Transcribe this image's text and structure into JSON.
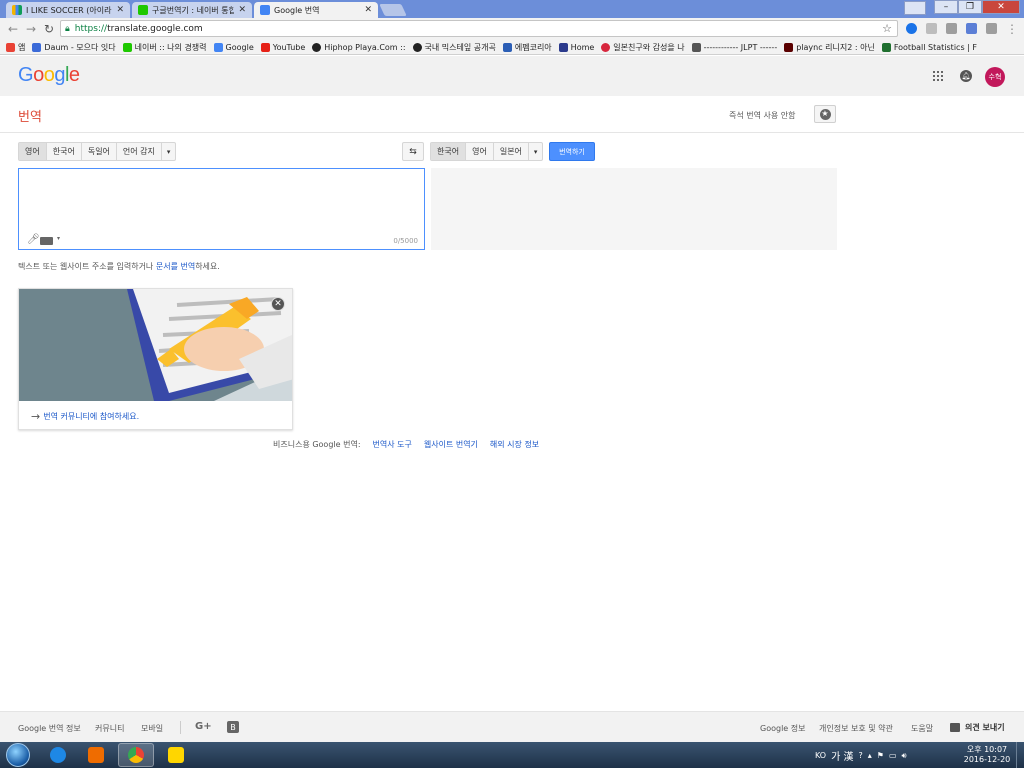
{
  "browser": {
    "tabs": [
      {
        "title": "I LIKE SOCCER (아이라이",
        "active": false
      },
      {
        "title": "구글번역기 : 네이버 통합",
        "active": false
      },
      {
        "title": "Google 번역",
        "active": true
      }
    ],
    "address": {
      "scheme": "https://",
      "host": "translate.google.com"
    },
    "bookmarks": [
      {
        "label": "앱",
        "color": "#e94235"
      },
      {
        "label": "Daum - 모으다 잇다",
        "color": "#3b6ad8"
      },
      {
        "label": "네이버 :: 나의 경쟁력",
        "color": "#1ec800"
      },
      {
        "label": "Google",
        "color": "#4285f4"
      },
      {
        "label": "YouTube",
        "color": "#e62117"
      },
      {
        "label": "Hiphop Playa.Com ::",
        "color": "#222222"
      },
      {
        "label": "국내 믹스테잎 공개곡",
        "color": "#222222"
      },
      {
        "label": "에펨코리아",
        "color": "#2b5eb5"
      },
      {
        "label": "Home",
        "color": "#2b3a8c"
      },
      {
        "label": "일본친구와 감성을 나",
        "color": "#d7263d"
      },
      {
        "label": "------------ JLPT ------",
        "color": "#555555"
      },
      {
        "label": "plaync 리니지2 : 아닌",
        "color": "#5a0000"
      },
      {
        "label": "Football Statistics | F",
        "color": "#1f6f2f"
      }
    ]
  },
  "header": {
    "logo": "Google",
    "avatar_text": "수혁"
  },
  "subheader": {
    "title": "번역",
    "instant_label": "즉석 번역 사용 안함"
  },
  "source_langs": {
    "items": [
      "영어",
      "한국어",
      "독일어",
      "언어 감지"
    ],
    "selected": 0
  },
  "target_langs": {
    "items": [
      "한국어",
      "영어",
      "일본어"
    ],
    "selected": 0
  },
  "translate_button": "번역하기",
  "source": {
    "value": "",
    "char_count": "0/5000"
  },
  "hint": {
    "prefix": "텍스트 또는 웹사이트 주소를 입력하거나 ",
    "link": "문서를 번역",
    "suffix": "하세요."
  },
  "card": {
    "link": "번역 커뮤니티에 참여하세요."
  },
  "business": {
    "label": "비즈니스용 Google 번역:",
    "links": [
      "번역사 도구",
      "웹사이트 번역기",
      "해외 시장 정보"
    ]
  },
  "footer": {
    "left": [
      "Google 번역 정보",
      "커뮤니티",
      "모바일"
    ],
    "right": [
      "Google 정보",
      "개인정보 보호 및 약관",
      "도움말"
    ],
    "feedback": "의견 보내기"
  },
  "taskbar": {
    "lang_indicator": "KO",
    "ime": "가 漢",
    "clock_line1": "오후 10:07",
    "clock_line2": "2016-12-20"
  },
  "colors": {
    "accent_blue": "#4d90fe",
    "title_red": "#dd4b39",
    "link_blue": "#1a57c8",
    "avatar": "#c2185b"
  }
}
